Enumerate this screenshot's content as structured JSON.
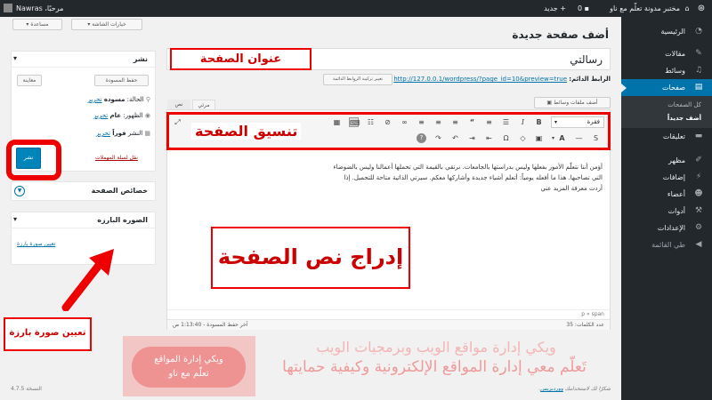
{
  "adminbar": {
    "site_name": "مختبر مدونة تعلّم مع ناو",
    "comments_count": "0",
    "new_label": "جديد",
    "greeting": "مرحبًا، Nawras"
  },
  "sidebar": {
    "items": [
      {
        "label": "الرئيسية",
        "icon": "dashboard-icon"
      },
      {
        "label": "مقالات",
        "icon": "pin-icon"
      },
      {
        "label": "وسائط",
        "icon": "media-icon"
      },
      {
        "label": "صفحات",
        "icon": "pages-icon"
      },
      {
        "label": "تعليقات",
        "icon": "comments-icon"
      },
      {
        "label": "مظهر",
        "icon": "appearance-icon"
      },
      {
        "label": "إضافات",
        "icon": "plugins-icon"
      },
      {
        "label": "أعضاء",
        "icon": "users-icon"
      },
      {
        "label": "أدوات",
        "icon": "tools-icon"
      },
      {
        "label": "الإعدادات",
        "icon": "settings-icon"
      },
      {
        "label": "طي القائمة",
        "icon": "collapse-icon"
      }
    ],
    "submenu": [
      "كل الصفحات",
      "أضف جديداً"
    ]
  },
  "top_buttons": {
    "screen_options": "خيارات الشاشة",
    "help": "مساعدة"
  },
  "page": {
    "title": "أضف صفحة جديدة",
    "post_title": "رسالتي",
    "permalink_label": "الرابط الدائم:",
    "permalink_url": "http://127.0.0.1/wordpress/?page_id=10&preview=true",
    "permalink_button": "تغيير تركيبة الروابط الدائمة",
    "add_media": "أضف ملفات وسائط",
    "tab_visual": "مرئي",
    "tab_text": "نص",
    "format_select": "فقرة",
    "content_lines": [
      "أؤمن أننا نتعلّم الأمور بفعلها وليس بدراستها بالجامعات. نرتقي بالقيمة التي تحملها أعمالنا وليس بالضوضاء",
      "التي تصاحبها. هذا ما أفعله يومياً: أتعلم أشياء جديدة وأشاركها معكم. سيرتي الذاتية متاحة للتحميل. إذا",
      "أردت معرفة المزيد عني"
    ],
    "path": "p « span",
    "word_count": "عدد الكلمات: 35",
    "draft_saved": "آخر حفظ المسودة - 1:13:40 ص",
    "footer_thanks": "شكرًا لك لاستخدامك",
    "footer_link": "ووردبريس",
    "version": "النسخة 4.7.5"
  },
  "publish": {
    "title": "نشر",
    "save_draft": "حفظ المسودة",
    "preview": "معاينة",
    "status_label": "الحالة:",
    "status_value": "مسوده",
    "visibility_label": "الظهور:",
    "visibility_value": "عام",
    "schedule_label": "النشر",
    "schedule_value": "فوراً",
    "edit": "تحرير",
    "trash": "نقل لسلة المهملات",
    "publish_button": "نشر"
  },
  "page_attributes": {
    "title": "خصائص الصفحة"
  },
  "featured_image": {
    "title": "الصوره البارزه",
    "link": "تعيين صورة بارزة"
  },
  "annotations": {
    "title": "عنوان الصفحة",
    "format": "تنسيق الصفحة",
    "content": "إدراج نص الصفحة",
    "featured": "تعيين صورة بارزة"
  },
  "watermark": {
    "badge_line1": "ويكي إدارة المواقع",
    "badge_line2": "تعلّم مع ناو",
    "line1": "ويكي إدارة مواقع الويب وبرمجيات الويب",
    "line2": "تَعلّم معي إدارة المواقع الإلكترونية وكيفية حمايتها"
  },
  "colors": {
    "accent": "#0073aa",
    "annotation_red": "#e00000",
    "admin_dark": "#23282d"
  }
}
